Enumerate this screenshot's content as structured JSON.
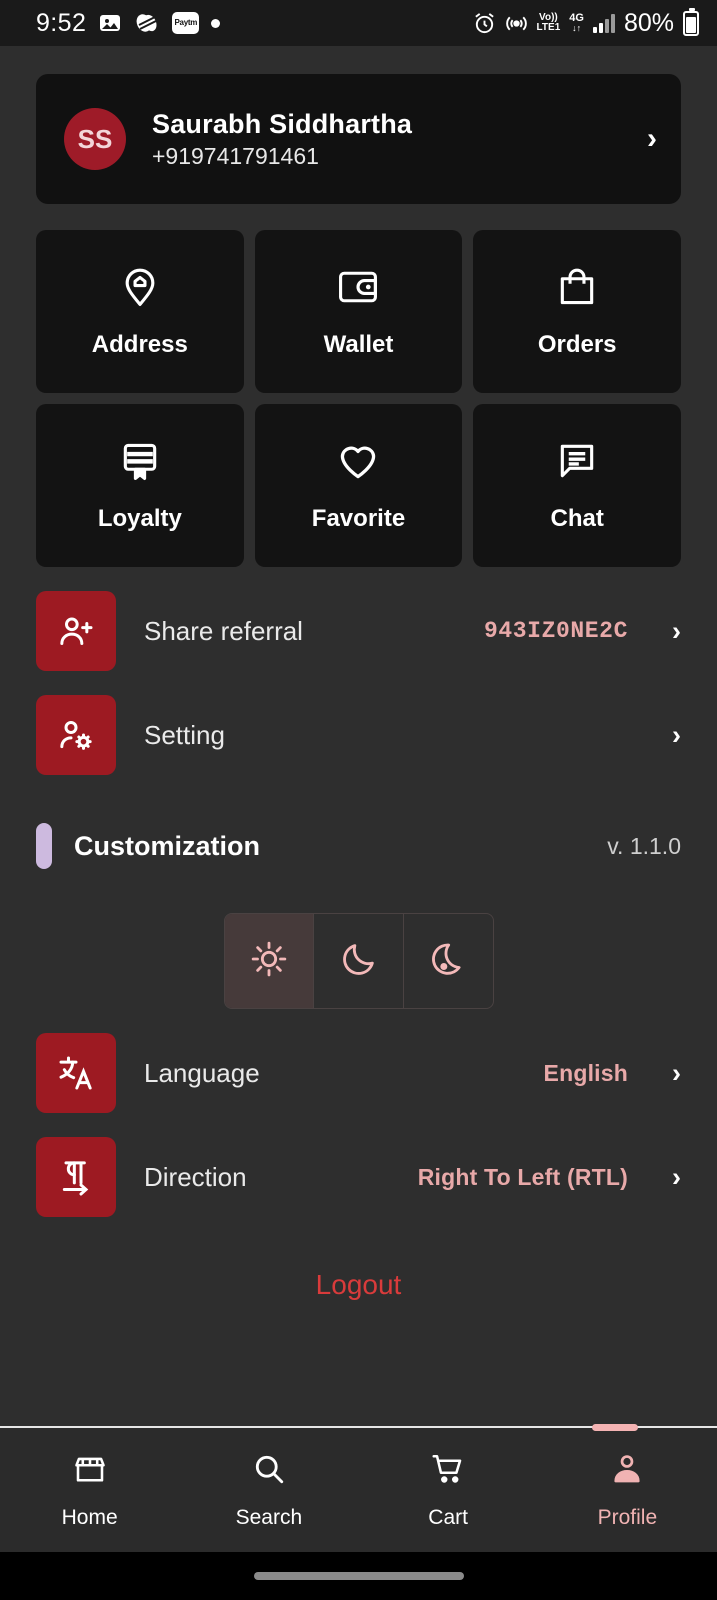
{
  "status_bar": {
    "time": "9:52",
    "left_icons": [
      "photo-icon",
      "app-swirl-icon",
      "paytm-icon",
      "dot-icon"
    ],
    "paytm_label": "Paytm",
    "right_icons": [
      "alarm-icon",
      "hotspot-icon",
      "volte-icon",
      "4g-icon",
      "signal-icon"
    ],
    "volte_top": "Vo))",
    "volte_bottom": "LTE1",
    "net_label": "4G",
    "net_arrows": "↓↑",
    "battery": "80%"
  },
  "profile": {
    "initials": "SS",
    "name": "Saurabh Siddhartha",
    "phone": "+919741791461",
    "chevron": "›"
  },
  "tiles": [
    {
      "label": "Address",
      "icon": "location-pin-home-icon"
    },
    {
      "label": "Wallet",
      "icon": "wallet-icon"
    },
    {
      "label": "Orders",
      "icon": "shopping-bag-icon"
    },
    {
      "label": "Loyalty",
      "icon": "loyalty-card-icon"
    },
    {
      "label": "Favorite",
      "icon": "heart-icon"
    },
    {
      "label": "Chat",
      "icon": "chat-bubble-icon"
    }
  ],
  "rows": {
    "share_referral": {
      "label": "Share referral",
      "value": "943IZ0NE2C",
      "icon": "user-add-icon",
      "chevron": "›"
    },
    "setting": {
      "label": "Setting",
      "value": "",
      "icon": "user-gear-icon",
      "chevron": "›"
    },
    "language": {
      "label": "Language",
      "value": "English",
      "icon": "translate-icon",
      "chevron": "›"
    },
    "direction": {
      "label": "Direction",
      "value": "Right To Left (RTL)",
      "icon": "text-direction-icon",
      "chevron": "›"
    }
  },
  "customization": {
    "title": "Customization",
    "version": "v. 1.1.0",
    "themes": [
      {
        "name": "light-theme",
        "icon": "sun-icon",
        "active": true
      },
      {
        "name": "dark-theme",
        "icon": "moon-icon",
        "active": false
      },
      {
        "name": "auto-theme",
        "icon": "moon-star-icon",
        "active": false
      }
    ]
  },
  "logout_label": "Logout",
  "bottom_nav": [
    {
      "label": "Home",
      "icon": "storefront-icon",
      "active": false
    },
    {
      "label": "Search",
      "icon": "search-icon",
      "active": false
    },
    {
      "label": "Cart",
      "icon": "cart-icon",
      "active": false
    },
    {
      "label": "Profile",
      "icon": "person-icon",
      "active": true
    }
  ],
  "colors": {
    "background": "#2e2e2e",
    "card": "#131313",
    "brand_red": "#9d1a22",
    "accent_pink": "#e8a9a9",
    "logout_red": "#d93b3b",
    "lavender": "#cdbadf"
  }
}
